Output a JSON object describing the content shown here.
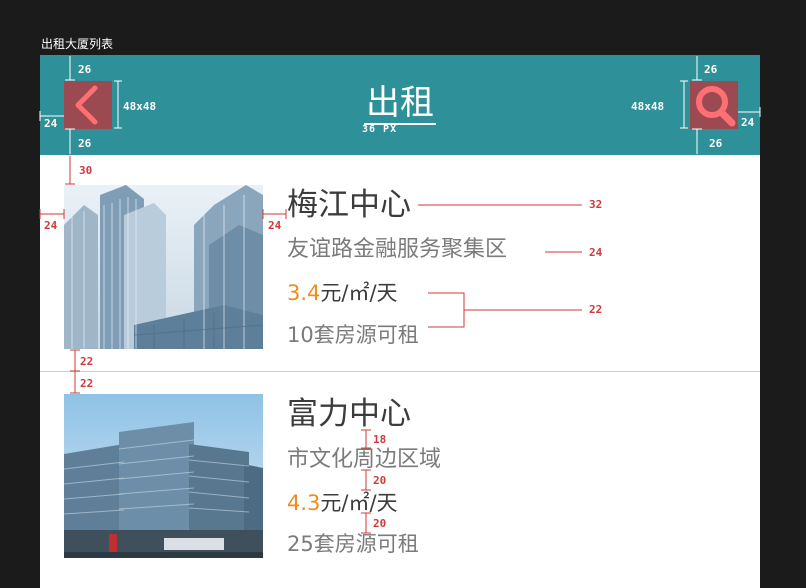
{
  "caption": "出租大厦列表",
  "header": {
    "title": "出租",
    "title_spec": "36 PX",
    "back_icon": "chevron-left-icon",
    "search_icon": "search-icon",
    "bg_color": "#2e9099",
    "button_color": "#9a4a50",
    "icon_color": "#ff6f73"
  },
  "buildings": [
    {
      "name": "梅江中心",
      "region": "友谊路金融服务聚集区",
      "price_value": "3.4",
      "price_unit": "元/㎡/天",
      "available": "10套房源可租"
    },
    {
      "name": "富力中心",
      "region": "市文化周边区域",
      "price_value": "4.3",
      "price_unit": "元/㎡/天",
      "available": "25套房源可租"
    }
  ],
  "annotations": {
    "top_gap": "26",
    "bottom_gap": "26",
    "side_gap": "24",
    "button_size": "48x48",
    "list_top_gap": "30",
    "photo_side_gap": "24",
    "photo_text_gap": "24",
    "name_size": "32",
    "region_size": "24",
    "price_size": "22",
    "row_gap": "22",
    "line_gap_1": "18",
    "line_gap_2": "20",
    "line_gap_3": "20"
  },
  "accent_colors": {
    "price": "#f08c1e",
    "spec": "#d03a3a"
  }
}
